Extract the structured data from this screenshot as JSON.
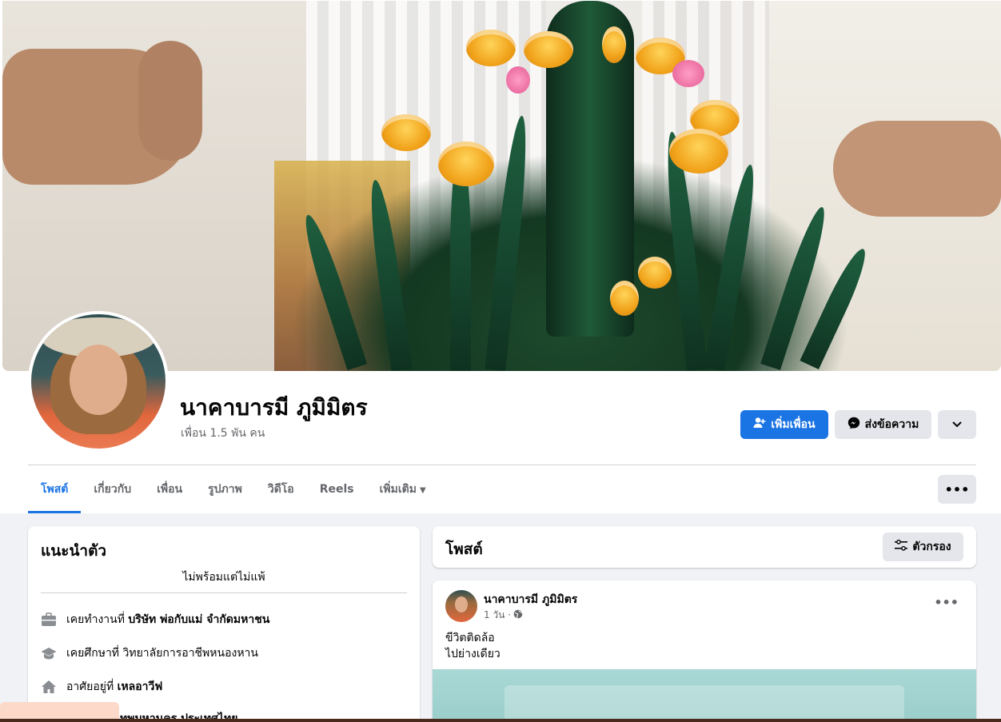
{
  "profile": {
    "name": "นาคาบารมี ภูมิมิตร",
    "friends": "เพื่อน 1.5 พัน คน"
  },
  "actions": {
    "add_friend": "เพิ่มเพื่อน",
    "message": "ส่งข้อความ"
  },
  "tabs": [
    {
      "label": "โพสต์"
    },
    {
      "label": "เกี่ยวกับ"
    },
    {
      "label": "เพื่อน"
    },
    {
      "label": "รูปภาพ"
    },
    {
      "label": "วิดีโอ"
    },
    {
      "label": "Reels"
    },
    {
      "label": "เพิ่มเติม"
    }
  ],
  "intro": {
    "title": "แนะนำตัว",
    "bio": "ไม่พร้อมแต่ไม่แพ้",
    "items": [
      {
        "prefix": "เคยทำงานที่",
        "value": "บริษัท พ่อกับแม่ จำกัดมหาชน",
        "icon": "briefcase-icon"
      },
      {
        "prefix": "เคยศึกษาที่ วิทยาลัยการอาชีพหนองหาน",
        "value": "",
        "icon": "graduation-cap-icon"
      },
      {
        "prefix": "อาศัยอยู่ที่",
        "value": "เหลอาวีฟ",
        "icon": "home-icon"
      },
      {
        "prefix": "",
        "value": "ทพมหานคร ประเทศไทย",
        "icon": "location-icon"
      }
    ]
  },
  "posts_header": {
    "title": "โพสต์",
    "filter": "ตัวกรอง"
  },
  "post": {
    "author": "นาคาบารมี ภูมิมิตร",
    "time": "1 วัน ·",
    "lines": [
      "ขีวิตติดล้อ",
      "ไปย่างเดียว"
    ]
  },
  "colors": {
    "accent": "#1b74e4",
    "background": "#f0f2f5",
    "button_gray": "#e4e6eb"
  }
}
